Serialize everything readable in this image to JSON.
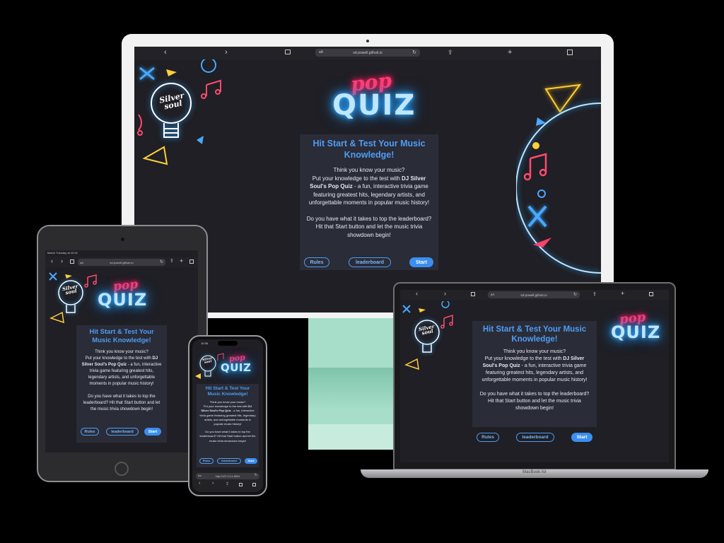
{
  "site": {
    "url_desktop": "sd-powell.github.io",
    "url_ipad": "sd-powell.github.io",
    "url_phone": "http://127.0.0.1:5501",
    "aa": "aA",
    "aa_phone": "Aa",
    "logo_pop": "pop",
    "logo_quiz": "QUIZ",
    "bulb_line1": "Silver",
    "bulb_line2": "soul",
    "heading": "Hit Start & Test Your Music Knowledge!",
    "intro_q": "Think you know your music?",
    "intro_pre": "Put your knowledge to the test with ",
    "intro_bold": "DJ Silver Soul's Pop Quiz",
    "intro_post": " - a fun, interactive trivia game featuring greatest hits, legendary artists, and unforgettable moments in popular music history!",
    "cta": "Do you have what it takes to top the leaderboard? Hit that Start button and let the music trivia showdown begin!",
    "btn_rules": "Rules",
    "btn_leaderboard": "leaderboard",
    "btn_start": "Start"
  },
  "ipad_status": "March Tuesday at 10:31",
  "phone_status_time": "10:36",
  "macbook_label": "MacBook Air",
  "icons": [
    "back-chevron-icon",
    "forward-chevron-icon",
    "reader-icon",
    "reload-icon",
    "share-icon",
    "plus-icon",
    "tabs-icon",
    "lightbulb-icon",
    "music-note-icon",
    "cross-icon",
    "triangle-icon",
    "circle-icon"
  ],
  "colors": {
    "accent": "#4f9df3",
    "card": "#2a2c38",
    "page_bg": "#1f1f25",
    "neon_pink": "#ff3f74",
    "neon_blue": "#2ea8ff",
    "imac_stand": "#a7dec9"
  }
}
